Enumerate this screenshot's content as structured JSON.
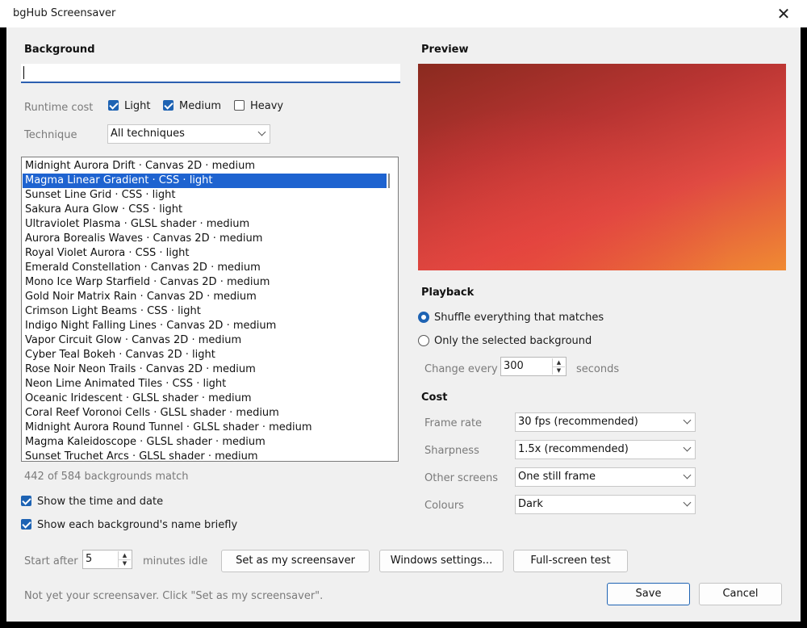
{
  "window": {
    "title": "bgHub Screensaver",
    "close_glyph": "✕"
  },
  "background_section": {
    "heading": "Background",
    "search_value": "",
    "runtime_cost_label": "Runtime cost",
    "cost_options": [
      {
        "label": "Light",
        "checked": true
      },
      {
        "label": "Medium",
        "checked": true
      },
      {
        "label": "Heavy",
        "checked": false
      }
    ],
    "technique_label": "Technique",
    "technique_value": "All techniques",
    "items": [
      "Midnight Aurora Drift · Canvas 2D · medium",
      "Magma Linear Gradient · CSS · light",
      "Sunset Line Grid · CSS · light",
      "Sakura Aura Glow · CSS · light",
      "Ultraviolet Plasma · GLSL shader · medium",
      "Aurora Borealis Waves · Canvas 2D · medium",
      "Royal Violet Aurora · CSS · light",
      "Emerald Constellation · Canvas 2D · medium",
      "Mono Ice Warp Starfield · Canvas 2D · medium",
      "Gold Noir Matrix Rain · Canvas 2D · medium",
      "Crimson Light Beams · CSS · light",
      "Indigo Night Falling Lines · Canvas 2D · medium",
      "Vapor Circuit Glow · Canvas 2D · medium",
      "Cyber Teal Bokeh · Canvas 2D · light",
      "Rose Noir Neon Trails · Canvas 2D · medium",
      "Neon Lime Animated Tiles · CSS · light",
      "Oceanic Iridescent · GLSL shader · medium",
      "Coral Reef Voronoi Cells · GLSL shader · medium",
      "Midnight Aurora Round Tunnel · GLSL shader · medium",
      "Magma Kaleidoscope · GLSL shader · medium",
      "Sunset Truchet Arcs · GLSL shader · medium"
    ],
    "selected_index": 1,
    "match_count": "442 of 584 backgrounds match"
  },
  "options": {
    "show_time": {
      "label": "Show the time and date",
      "checked": true
    },
    "show_name": {
      "label": "Show each background's name briefly",
      "checked": true
    }
  },
  "preview": {
    "heading": "Preview"
  },
  "playback": {
    "heading": "Playback",
    "option_shuffle": "Shuffle everything that matches",
    "option_selected": "Only the selected background",
    "change_every_label": "Change every",
    "change_every_value": "300",
    "seconds_label": "seconds"
  },
  "cost": {
    "heading": "Cost",
    "frame_rate_label": "Frame rate",
    "frame_rate_value": "30 fps (recommended)",
    "sharpness_label": "Sharpness",
    "sharpness_value": "1.5x (recommended)",
    "other_screens_label": "Other screens",
    "other_screens_value": "One still frame",
    "colours_label": "Colours",
    "colours_value": "Dark"
  },
  "footer": {
    "start_after_label": "Start after",
    "start_after_value": "5",
    "minutes_idle_label": "minutes idle",
    "set_screensaver_button": "Set as my screensaver",
    "windows_settings_button": "Windows settings...",
    "fullscreen_test_button": "Full-screen test",
    "status_text": "Not yet your screensaver. Click \"Set as my screensaver\".",
    "save_button": "Save",
    "cancel_button": "Cancel"
  },
  "colors": {
    "accent": "#1e63b3",
    "selection": "#1e63d0"
  }
}
